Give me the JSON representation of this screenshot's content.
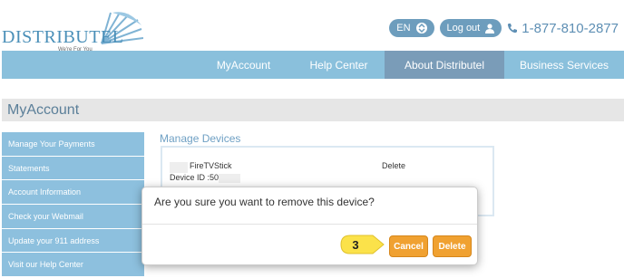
{
  "header": {
    "logo_text": "DISTRIBUTEL",
    "logo_tagline": "We're For You",
    "lang_label": "EN",
    "logout_label": "Log out",
    "phone": "1-877-810-2877"
  },
  "nav": {
    "items": [
      "MyAccount",
      "Help Center",
      "About Distributel",
      "Business Services"
    ],
    "active_index": 2
  },
  "page": {
    "title": "MyAccount"
  },
  "sidebar": {
    "items": [
      "Manage Your Payments",
      "Statements",
      "Account Information",
      "Check your Webmail",
      "Update your 911 address",
      "Visit our Help Center"
    ]
  },
  "main": {
    "section_title": "Manage Devices",
    "device": {
      "name": "FireTVStick",
      "id_prefix": "Device ID :50",
      "delete_label": "Delete"
    }
  },
  "modal": {
    "message": "Are you sure you want to remove this device?",
    "cancel_label": "Cancel",
    "delete_label": "Delete"
  },
  "callout": {
    "step": "3"
  },
  "colors": {
    "nav_bg": "#8ac0dc",
    "nav_active": "#7a9cb8",
    "sidebar_bg": "#8dc0de",
    "button_orange": "#f0a131",
    "callout_yellow": "#fbe24a",
    "brand_blue": "#4a8fb8"
  },
  "icons": [
    "sunburst-logo-icon",
    "chevron-updown-icon",
    "user-icon",
    "phone-icon"
  ]
}
